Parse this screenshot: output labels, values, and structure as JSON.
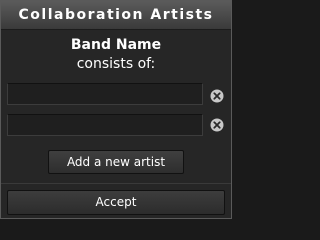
{
  "dialog": {
    "title": "Collaboration Artists",
    "band_name": "Band Name",
    "subtitle": "consists of:",
    "artists": [
      {
        "value": ""
      },
      {
        "value": ""
      }
    ],
    "remove_icon": "close-circle-icon",
    "add_label": "Add a new artist",
    "accept_label": "Accept"
  },
  "colors": {
    "background": "#262626",
    "titlebar_top": "#5b5b5b",
    "titlebar_bottom": "#3a3a3a",
    "text": "#ffffff",
    "icon": "#c8c8c8"
  }
}
